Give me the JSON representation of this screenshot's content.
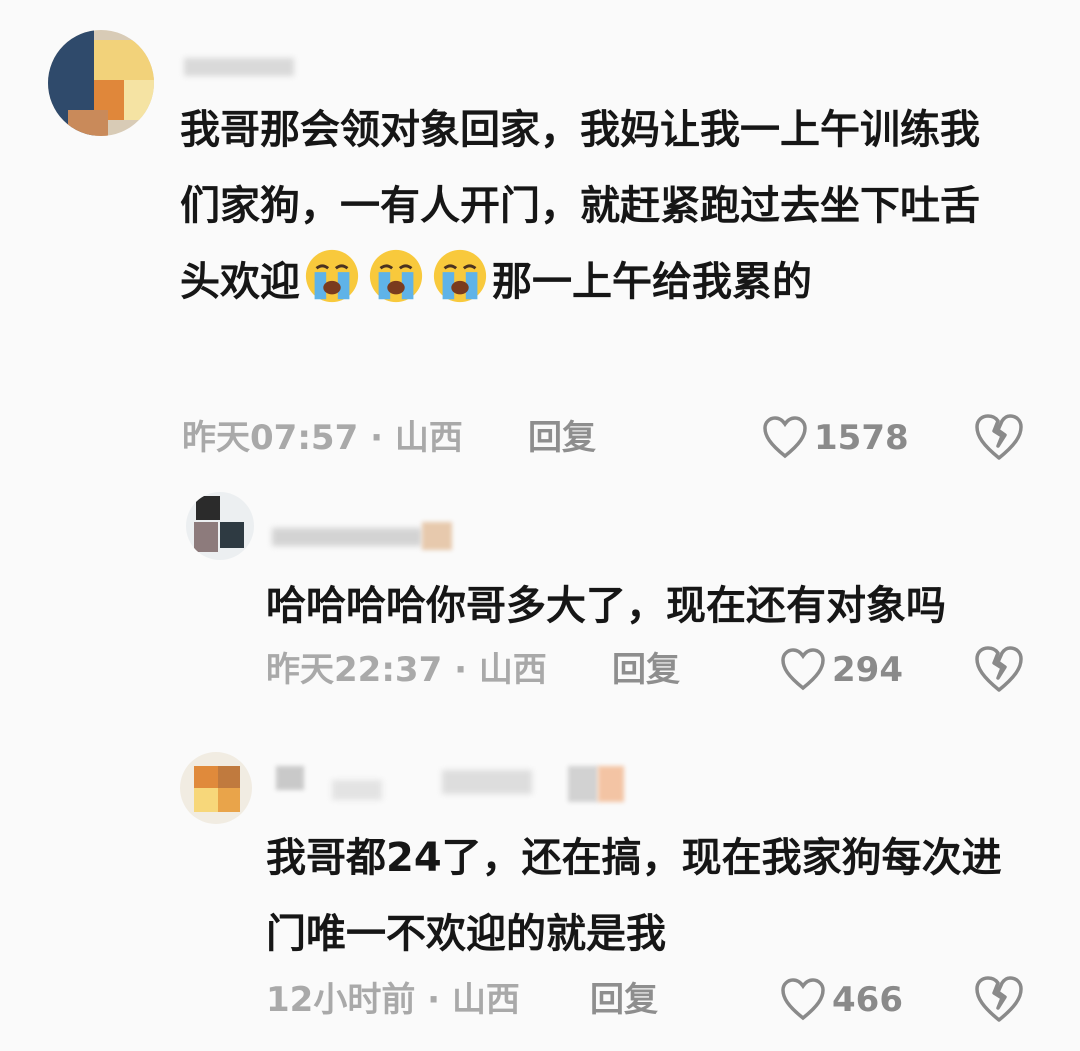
{
  "comments": [
    {
      "text_before": "我哥那会领对象回家，我妈让我一上午训练我们家狗，一有人开门，就赶紧跑过去坐下吐舌头欢迎",
      "emoji": [
        "loudly-crying-face",
        "loudly-crying-face",
        "loudly-crying-face"
      ],
      "text_after": "那一上午给我累的",
      "time": "昨天07:57",
      "separator": "·",
      "location": "山西",
      "reply_label": "回复",
      "likes": "1578"
    },
    {
      "text_before": "哈哈哈哈你哥多大了，现在还有对象吗",
      "time": "昨天22:37",
      "separator": "·",
      "location": "山西",
      "reply_label": "回复",
      "likes": "294"
    },
    {
      "text_before": "我哥都24了，还在搞，现在我家狗每次进门唯一不欢迎的就是我",
      "time": "12小时前",
      "separator": "·",
      "location": "山西",
      "reply_label": "回复",
      "likes": "466"
    }
  ],
  "icons": {
    "like": "heart-outline-icon",
    "dislike": "broken-heart-icon"
  },
  "colors": {
    "background": "#fafafa",
    "text": "#161616",
    "meta": "#a9a9a9",
    "icon": "#8a8a8a"
  }
}
